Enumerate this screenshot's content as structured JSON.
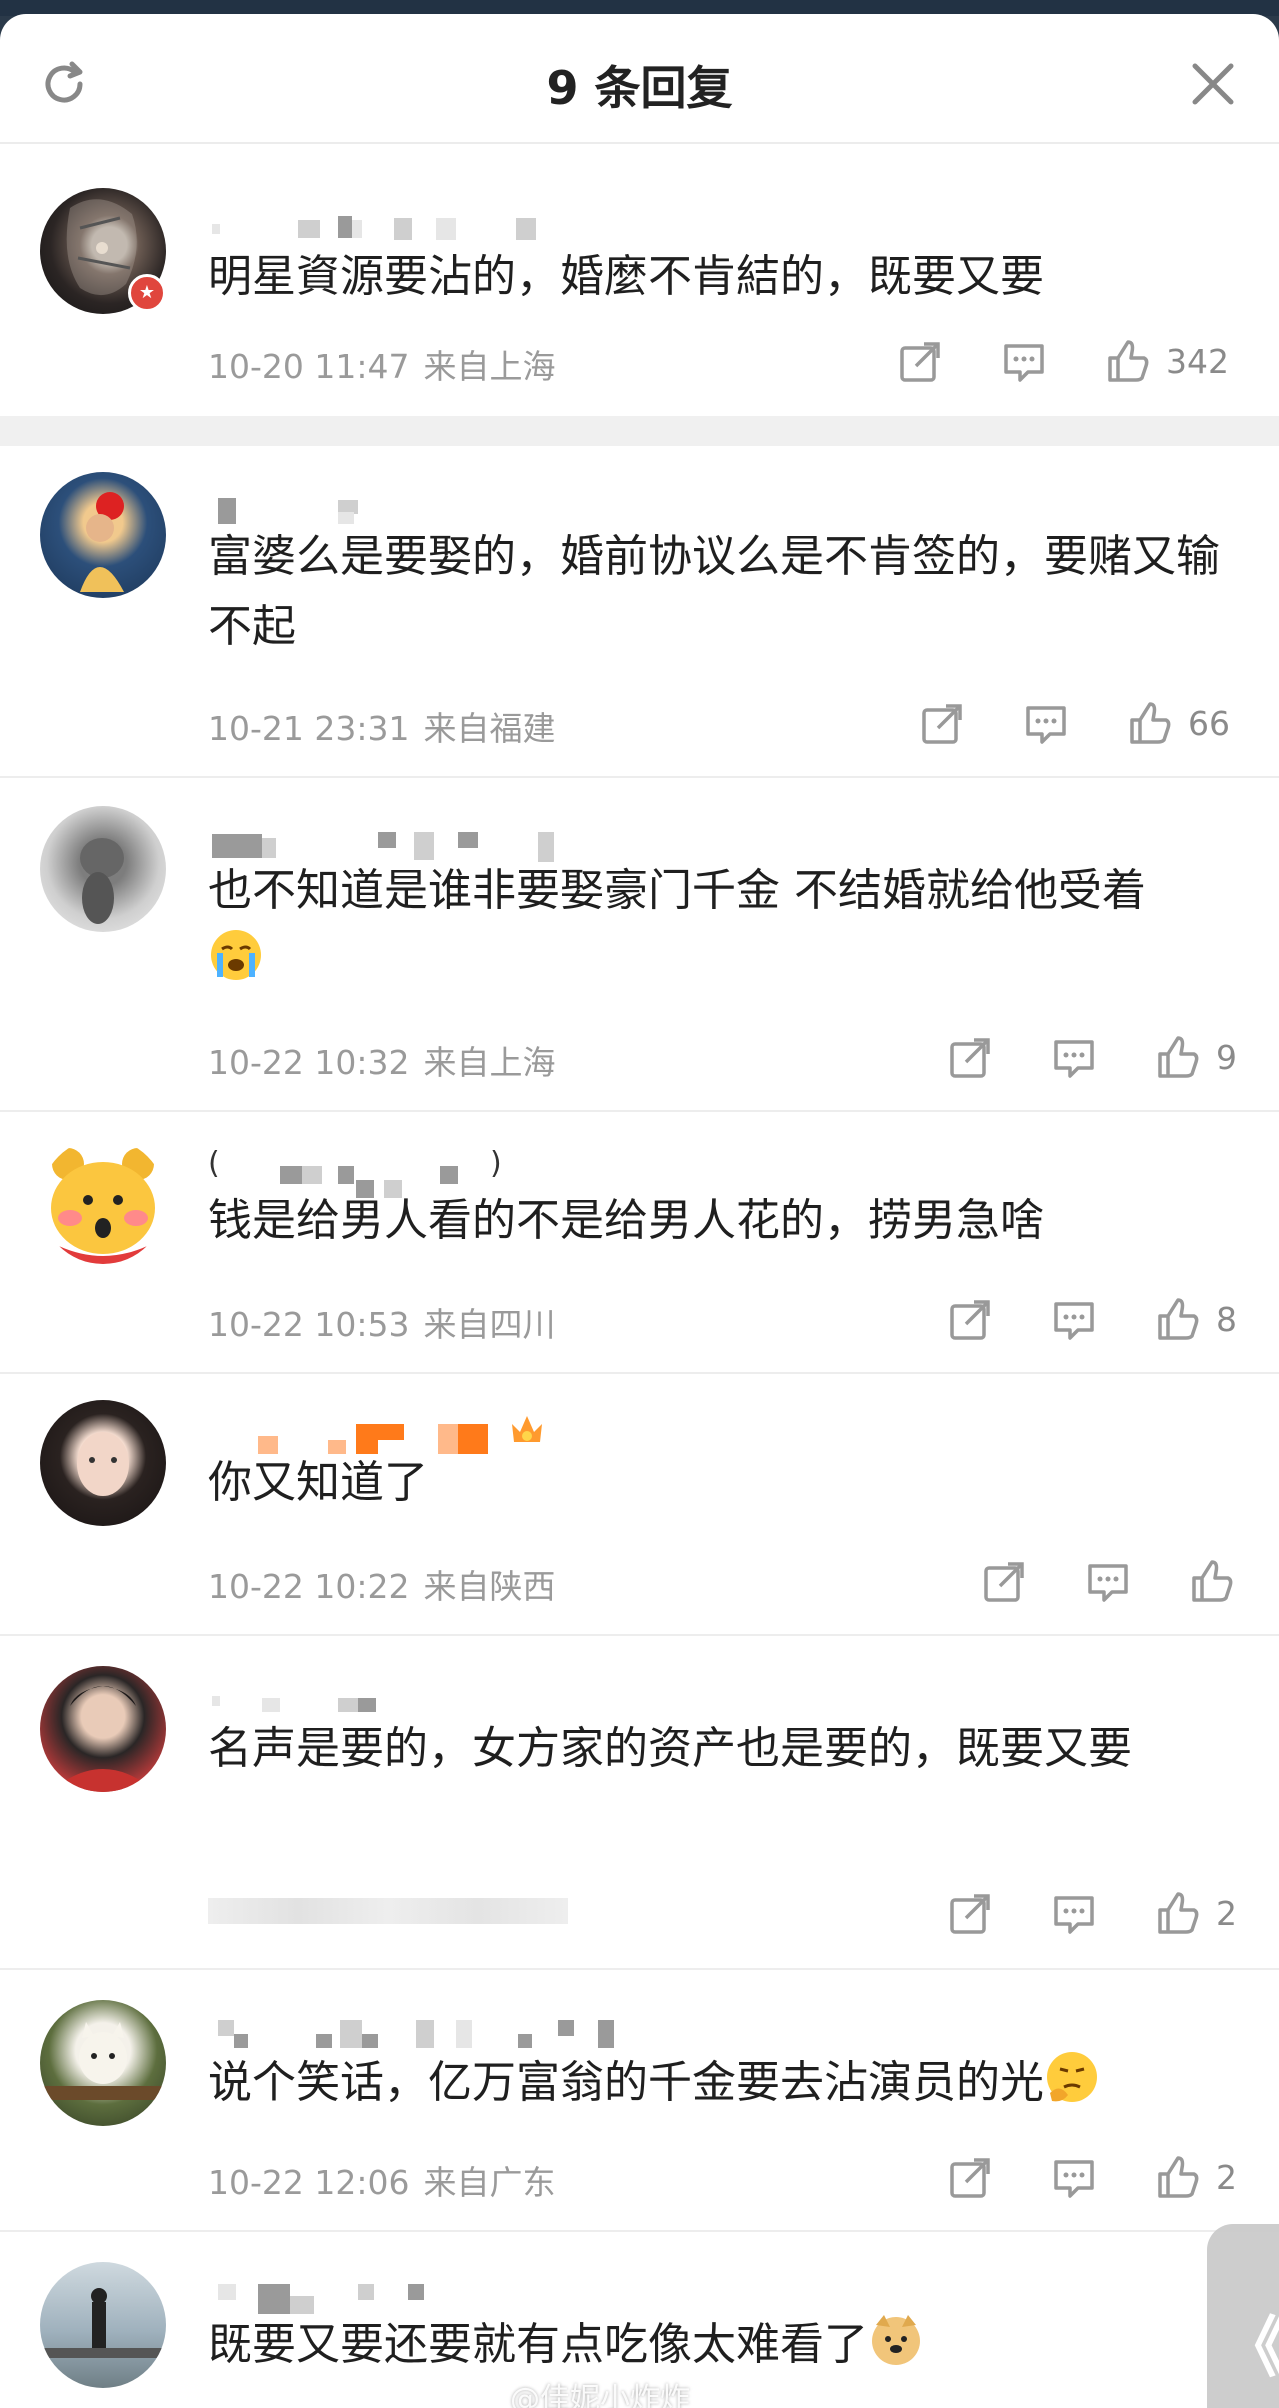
{
  "header": {
    "title": "9 条回复",
    "refresh_icon": "refresh-icon",
    "close_icon": "close-icon"
  },
  "comments": [
    {
      "text": "明星資源要沾的，婚麼不肯結的，既要又要",
      "date": "10-20 11:47",
      "location": "来自上海",
      "likes": "342",
      "avatar": "dark-portrait",
      "badge": "verified-badge"
    },
    {
      "text": "富婆么是要娶的，婚前协议么是不肯签的，要赌又输不起",
      "date": "10-21 23:31",
      "location": "来自福建",
      "likes": "66",
      "avatar": "flower-portrait"
    },
    {
      "text": "也不知道是谁非要娶豪门千金 不结婚就给他受着",
      "emoji": "crying-emoji",
      "date": "10-22 10:32",
      "location": "来自上海",
      "likes": "9",
      "avatar": "cat-photo"
    },
    {
      "text": "钱是给男人看的不是给男人花的，捞男急啥",
      "date": "10-22 10:53",
      "location": "来自四川",
      "likes": "8",
      "avatar": "bear-cartoon",
      "name_open": "(",
      "name_close": ")"
    },
    {
      "text": "你又知道了",
      "date": "10-22 10:22",
      "location": "来自陕西",
      "likes": "",
      "avatar": "girl-portrait",
      "badge": "crown-badge"
    },
    {
      "text": "名声是要的，女方家的资产也是要的，既要又要",
      "date": "",
      "location": "",
      "likes": "2",
      "avatar": "boy-portrait"
    },
    {
      "text": "说个笑话，亿万富翁的千金要去沾演员的光",
      "emoji": "thinking-emoji",
      "date": "10-22 12:06",
      "location": "来自广东",
      "likes": "2",
      "avatar": "dog-photo"
    },
    {
      "text": "既要又要还要就有点吃像太难看了",
      "emoji": "doge-emoji",
      "avatar": "lake-photo"
    }
  ],
  "side_tab": {
    "label": "《"
  },
  "watermark": "@佳妮小炸炸",
  "colors": {
    "accent_badge": "#e0463d",
    "text": "#1f1f1f",
    "meta": "#9a9a9a",
    "separator": "#ededed"
  }
}
